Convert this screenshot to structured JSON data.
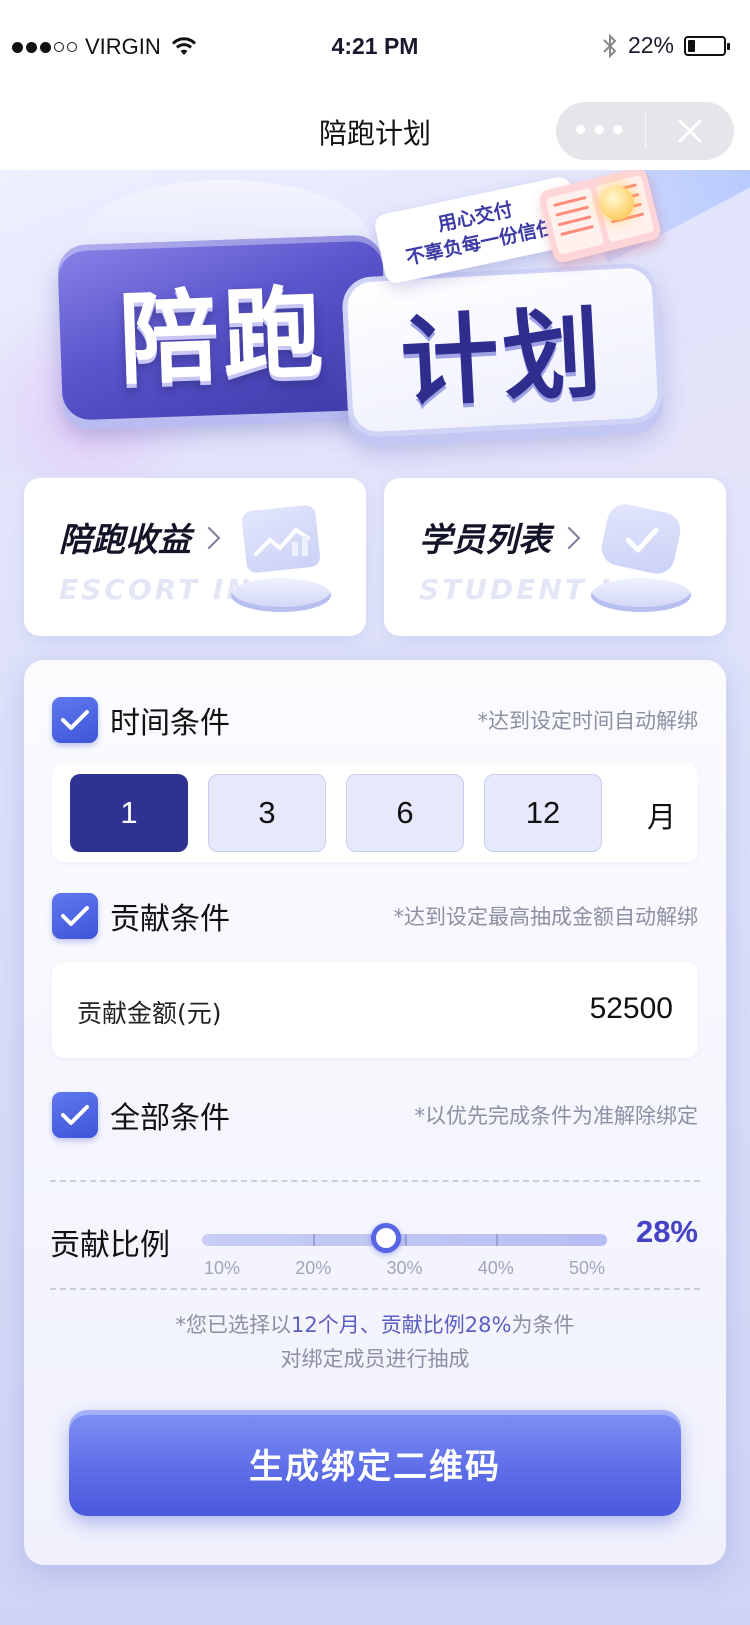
{
  "status_bar": {
    "carrier": "VIRGIN",
    "time": "4:21 PM",
    "battery": "22%"
  },
  "nav": {
    "title": "陪跑计划",
    "more_label": "•••"
  },
  "hero": {
    "title_left": "陪跑",
    "title_right": "计划",
    "tag_line1": "用心交付",
    "tag_line2": "不辜负每一份信任"
  },
  "quick_cards": [
    {
      "title": "陪跑收益",
      "subtitle": "ESCORT INCO"
    },
    {
      "title": "学员列表",
      "subtitle": "STUDENT LIS"
    }
  ],
  "conditions": {
    "time": {
      "label": "时间条件",
      "note": "*达到设定时间自动解绑",
      "checked": true
    },
    "contribution": {
      "label": "贡献条件",
      "note": "*达到设定最高抽成金额自动解绑",
      "checked": true
    },
    "all": {
      "label": "全部条件",
      "note": "*以优先完成条件为准解除绑定",
      "checked": true
    }
  },
  "months": {
    "options": [
      "1",
      "3",
      "6",
      "12"
    ],
    "selected": "1",
    "unit": "月"
  },
  "amount": {
    "label": "贡献金额(元)",
    "value": "52500"
  },
  "ratio": {
    "label": "贡献比例",
    "value_text": "28%",
    "value": 28,
    "min": 10,
    "max": 50,
    "ticks": [
      "10%",
      "20%",
      "30%",
      "40%",
      "50%"
    ]
  },
  "summary": {
    "prefix": "*您已选择以",
    "highlight": "12个月、贡献比例28%",
    "suffix": "为条件",
    "line2": "对绑定成员进行抽成"
  },
  "button": {
    "label": "生成绑定二维码"
  }
}
